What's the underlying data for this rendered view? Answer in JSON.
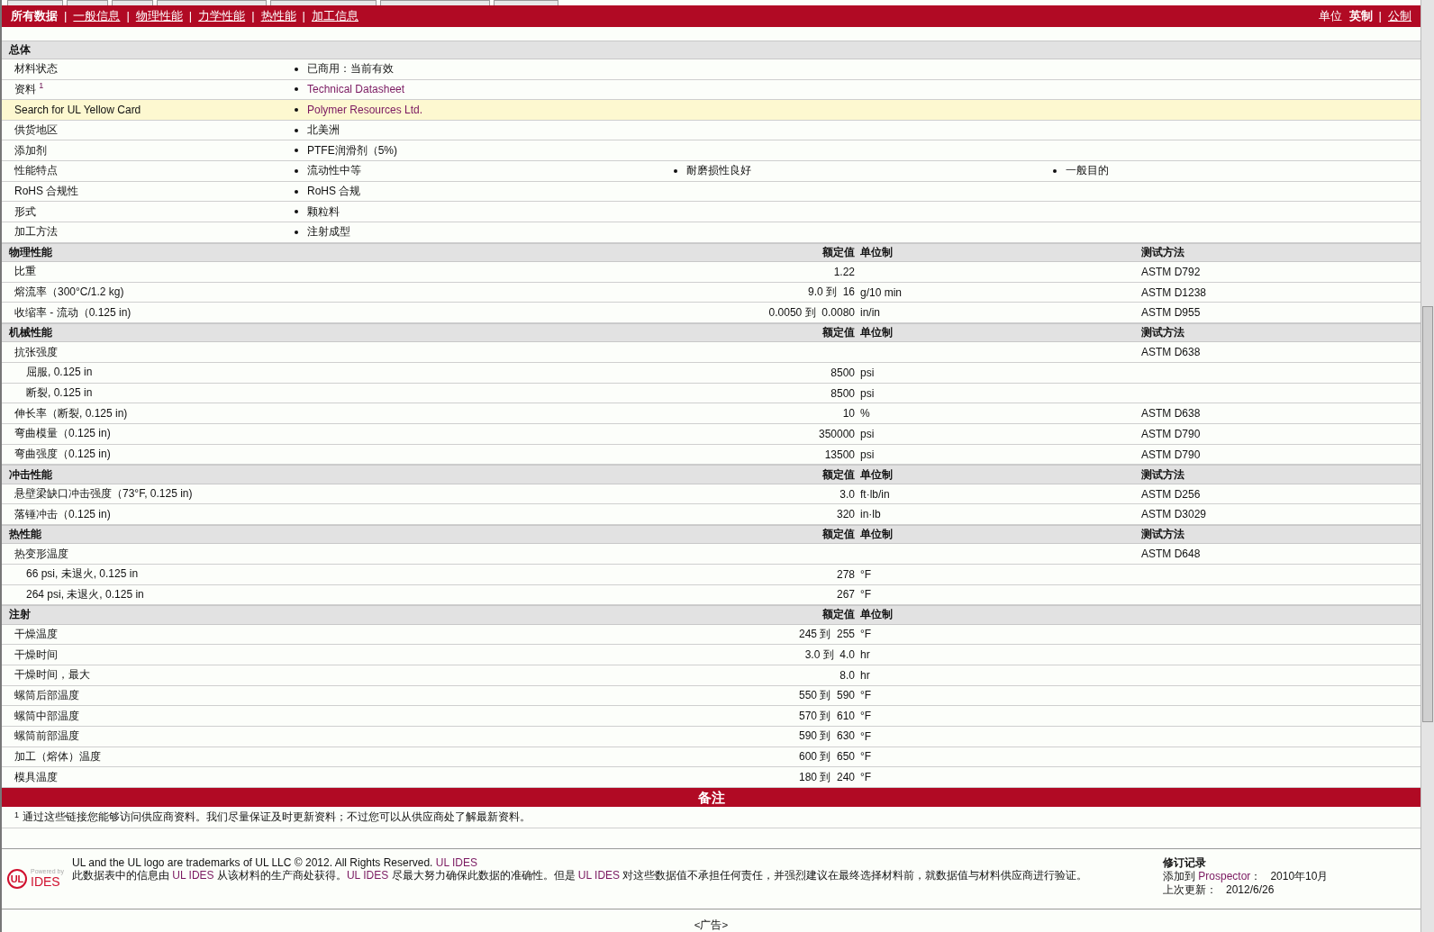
{
  "nav": {
    "tabs": [
      {
        "label": "所有数据",
        "selected": true
      },
      {
        "label": "一般信息",
        "selected": false
      },
      {
        "label": "物理性能",
        "selected": false
      },
      {
        "label": "力学性能",
        "selected": false
      },
      {
        "label": "热性能",
        "selected": false
      },
      {
        "label": "加工信息",
        "selected": false
      }
    ],
    "separator": "|",
    "units_label": "单位",
    "units": [
      {
        "label": "英制",
        "selected": true
      },
      {
        "label": "公制",
        "selected": false
      }
    ]
  },
  "general": {
    "title": "总体",
    "rows": [
      {
        "label": "材料状态",
        "highlighted": false,
        "values": [
          {
            "text": "已商用：当前有效",
            "link": false
          }
        ]
      },
      {
        "label": "资料",
        "sup": "1",
        "highlighted": false,
        "values": [
          {
            "text": "Technical Datasheet",
            "link": true
          }
        ]
      },
      {
        "label": "Search for UL Yellow Card",
        "highlighted": true,
        "values": [
          {
            "text": "Polymer Resources Ltd.",
            "link": true
          }
        ]
      },
      {
        "label": "供货地区",
        "highlighted": false,
        "values": [
          {
            "text": "北美洲",
            "link": false
          }
        ]
      },
      {
        "label": "添加剂",
        "highlighted": false,
        "values": [
          {
            "text": "PTFE润滑剂（5%)",
            "link": false
          }
        ]
      },
      {
        "label": "性能特点",
        "highlighted": false,
        "values": [
          {
            "text": "流动性中等",
            "link": false
          },
          {
            "text": "耐磨损性良好",
            "link": false
          },
          {
            "text": "一般目的",
            "link": false
          }
        ]
      },
      {
        "label": "RoHS 合规性",
        "highlighted": false,
        "values": [
          {
            "text": "RoHS 合规",
            "link": false
          }
        ]
      },
      {
        "label": "形式",
        "highlighted": false,
        "values": [
          {
            "text": "颗粒料",
            "link": false
          }
        ]
      },
      {
        "label": "加工方法",
        "highlighted": false,
        "values": [
          {
            "text": "注射成型",
            "link": false
          }
        ]
      }
    ]
  },
  "sections": [
    {
      "title": "物理性能",
      "headers": [
        "额定值",
        "单位制",
        "测试方法"
      ],
      "rows": [
        {
          "label": "比重",
          "value": "1.22",
          "method": "ASTM D792"
        },
        {
          "label": "熔流率（300°C/1.2 kg)",
          "value": "9.0 到  16",
          "unit": "g/10 min",
          "method": "ASTM D1238"
        },
        {
          "label": "收缩率 - 流动（0.125 in)",
          "value": "0.0050 到  0.0080",
          "unit": "in/in",
          "method": "ASTM D955"
        }
      ]
    },
    {
      "title": "机械性能",
      "headers": [
        "额定值",
        "单位制",
        "测试方法"
      ],
      "rows": [
        {
          "label": "抗张强度",
          "method": "ASTM D638",
          "children": [
            {
              "label": "屈服, 0.125 in",
              "value": "8500",
              "unit": "psi"
            },
            {
              "label": "断裂, 0.125 in",
              "value": "8500",
              "unit": "psi"
            }
          ]
        },
        {
          "label": "伸长率（断裂, 0.125 in)",
          "value": "10",
          "unit": "%",
          "method": "ASTM D638"
        },
        {
          "label": "弯曲模量（0.125 in)",
          "value": "350000",
          "unit": "psi",
          "method": "ASTM D790"
        },
        {
          "label": "弯曲强度（0.125 in)",
          "value": "13500",
          "unit": "psi",
          "method": "ASTM D790"
        }
      ]
    },
    {
      "title": "冲击性能",
      "headers": [
        "额定值",
        "单位制",
        "测试方法"
      ],
      "rows": [
        {
          "label": "悬壁梁缺口冲击强度（73°F, 0.125 in)",
          "value": "3.0",
          "unit": "ft·lb/in",
          "method": "ASTM D256"
        },
        {
          "label": "落锤冲击（0.125 in)",
          "value": "320",
          "unit": "in·lb",
          "method": "ASTM D3029"
        }
      ]
    },
    {
      "title": "热性能",
      "headers": [
        "额定值",
        "单位制",
        "测试方法"
      ],
      "rows": [
        {
          "label": "热变形温度",
          "method": "ASTM D648",
          "children": [
            {
              "label": "66 psi, 未退火, 0.125 in",
              "value": "278",
              "unit": "°F"
            },
            {
              "label": "264 psi, 未退火, 0.125 in",
              "value": "267",
              "unit": "°F"
            }
          ]
        }
      ]
    },
    {
      "title": "注射",
      "headers": [
        "额定值",
        "单位制"
      ],
      "rows": [
        {
          "label": "干燥温度",
          "value": "245 到  255",
          "unit": "°F"
        },
        {
          "label": "干燥时间",
          "value": "3.0 到  4.0",
          "unit": "hr"
        },
        {
          "label": "干燥时间，最大",
          "value": "8.0",
          "unit": "hr"
        },
        {
          "label": "螺筒后部温度",
          "value": "550 到  590",
          "unit": "°F"
        },
        {
          "label": "螺筒中部温度",
          "value": "570 到  610",
          "unit": "°F"
        },
        {
          "label": "螺筒前部温度",
          "value": "590 到  630",
          "unit": "°F"
        },
        {
          "label": "加工（熔体）温度",
          "value": "600 到  650",
          "unit": "°F"
        },
        {
          "label": "模具温度",
          "value": "180 到  240",
          "unit": "°F"
        }
      ]
    }
  ],
  "notes": {
    "title": "备注",
    "footnote": {
      "mark": "1",
      "text": "通过这些链接您能够访问供应商资料。我们尽量保证及时更新资料；不过您可以从供应商处了解最新资料。"
    }
  },
  "footer": {
    "logo": {
      "powered": "Powered by",
      "mark": "UL",
      "brand": "IDES"
    },
    "line1": [
      {
        "text": "UL and the UL logo are trademarks of UL LLC © 2012. All Rights Reserved. ",
        "link": false
      },
      {
        "text": "UL IDES",
        "link": true
      }
    ],
    "line2": [
      {
        "text": "此数据表中的信息由 ",
        "link": false
      },
      {
        "text": "UL IDES",
        "link": true
      },
      {
        "text": " 从该材料的生产商处获得。",
        "link": false
      },
      {
        "text": "UL IDES",
        "link": true
      },
      {
        "text": " 尽最大努力确保此数据的准确性。但是 ",
        "link": false
      },
      {
        "text": "UL IDES",
        "link": true
      },
      {
        "text": " 对这些数据值不承担任何责任，并强烈建议在最终选择材料前，就数据值与材料供应商进行验证。",
        "link": false
      }
    ],
    "revision": {
      "title": "修订记录",
      "added_label": "添加到",
      "added_link": "Prospector",
      "added_suffix": "：",
      "added_value": "2010年10月",
      "updated_label": "上次更新：",
      "updated_value": "2012/6/26"
    }
  },
  "ad": "<广告>"
}
